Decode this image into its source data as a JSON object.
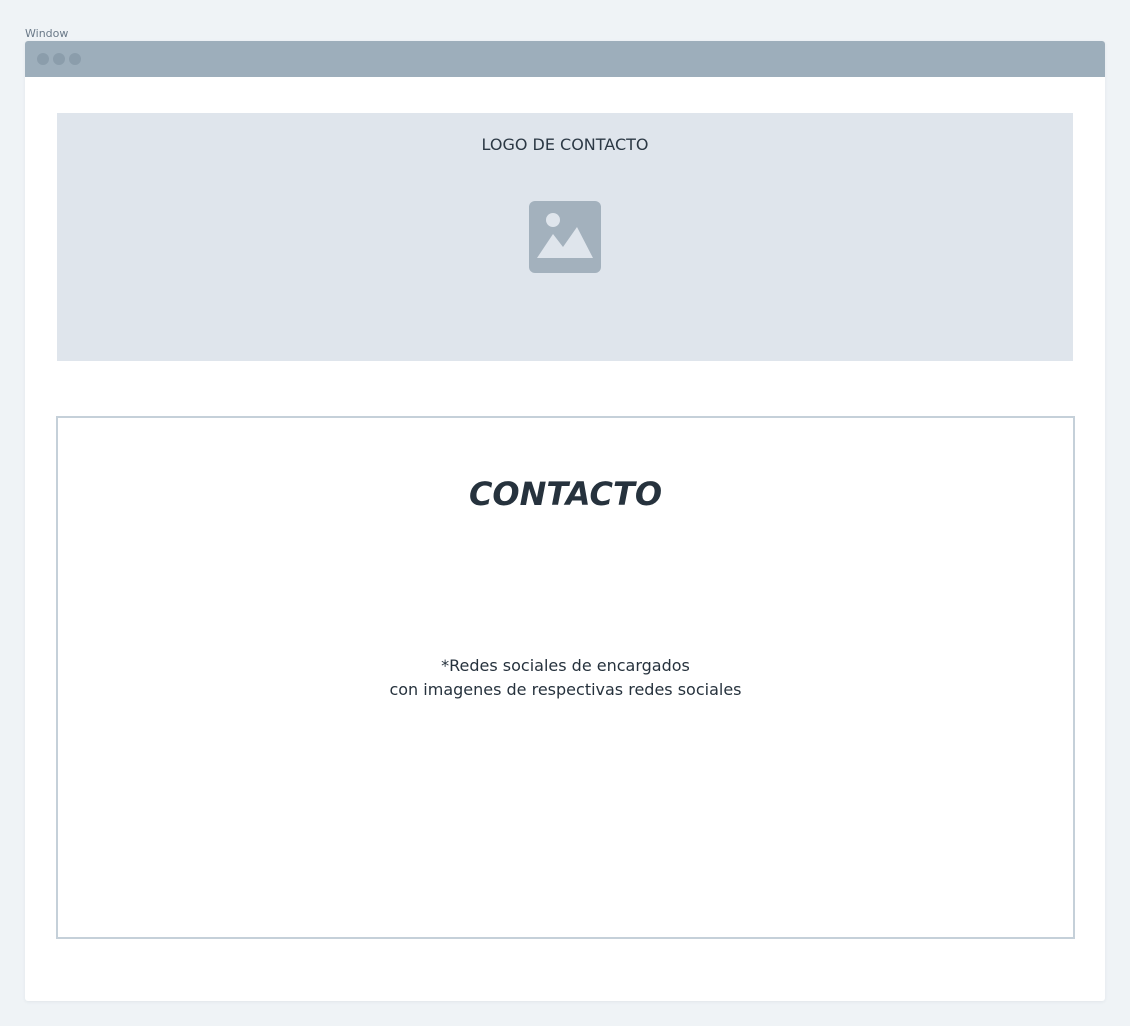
{
  "window": {
    "caption": "Window"
  },
  "logo_panel": {
    "label": "LOGO DE CONTACTO",
    "icon": "image-placeholder-icon"
  },
  "contact_panel": {
    "title": "CONTACTO",
    "note_lines": [
      "*Redes sociales de encargados",
      "con imagenes de respectivas redes sociales"
    ]
  },
  "colors": {
    "page_background": "#eff3f6",
    "titlebar": "#9daebb",
    "logo_panel": "#dfe5ec",
    "panel_border": "#c5d0d9",
    "text_dark": "#26323d",
    "icon_fill": "#a3b1bd"
  }
}
